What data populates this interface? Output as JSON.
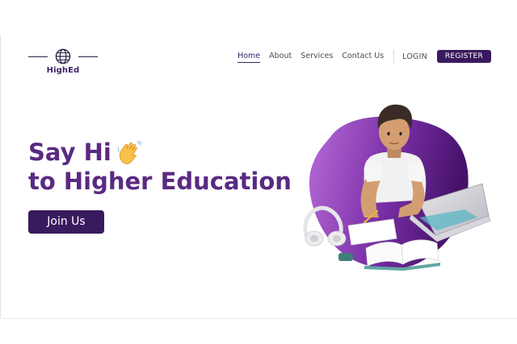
{
  "brand": {
    "name": "HighEd",
    "logo_icon": "globe-icon"
  },
  "nav": {
    "items": [
      {
        "label": "Home",
        "active": true
      },
      {
        "label": "About",
        "active": false
      },
      {
        "label": "Services",
        "active": false
      },
      {
        "label": "Contact Us",
        "active": false
      }
    ],
    "login_label": "LOGIN",
    "register_label": "REGISTER"
  },
  "hero": {
    "line1": "Say Hi",
    "line2": "to Higher Education",
    "emoji_icon": "waving-hand-icon",
    "cta_label": "Join Us"
  },
  "illustration": {
    "icon": "student-studying-illustration"
  },
  "colors": {
    "brand_dark": "#3a1a5e",
    "heading": "#5a2a82",
    "blob_light": "#b15fd0",
    "blob_dark": "#4a1670"
  }
}
